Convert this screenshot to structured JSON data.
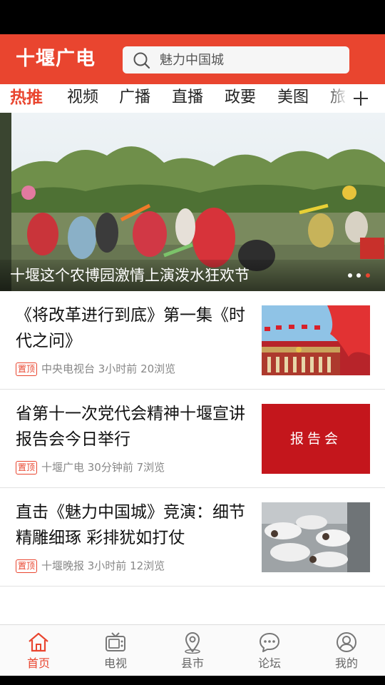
{
  "app": {
    "logo": "十堰广电",
    "search_placeholder": "魅力中国城",
    "brand_color": "#e9452f"
  },
  "tabs": [
    {
      "label": "热推",
      "active": true
    },
    {
      "label": "视频",
      "active": false
    },
    {
      "label": "广播",
      "active": false
    },
    {
      "label": "直播",
      "active": false
    },
    {
      "label": "政要",
      "active": false
    },
    {
      "label": "美图",
      "active": false
    },
    {
      "label": "旅",
      "active": false
    }
  ],
  "tab_add_icon": "plus-icon",
  "banner": {
    "caption": "十堰这个农博园激情上演泼水狂欢节",
    "pages": 3,
    "active_page": 3
  },
  "news": [
    {
      "title": "《将改革进行到底》第一集《时代之问》",
      "badge": "置顶",
      "source": "中央电视台 3小时前 20浏览",
      "thumb_text": ""
    },
    {
      "title": "省第十一次党代会精神十堰宣讲报告会今日举行",
      "badge": "置顶",
      "source": "十堰广电 30分钟前 7浏览",
      "thumb_text": "报告会"
    },
    {
      "title": "直击《魅力中国城》竞演：细节精雕细琢 彩排犹如打仗",
      "badge": "置顶",
      "source": "十堰晚报 3小时前 12浏览",
      "thumb_text": ""
    }
  ],
  "tabbar": [
    {
      "label": "首页",
      "icon": "home-icon",
      "active": true
    },
    {
      "label": "电视",
      "icon": "tv-icon",
      "active": false
    },
    {
      "label": "县市",
      "icon": "location-pin-icon",
      "active": false
    },
    {
      "label": "论坛",
      "icon": "chat-bubble-icon",
      "active": false
    },
    {
      "label": "我的",
      "icon": "user-icon",
      "active": false
    }
  ]
}
